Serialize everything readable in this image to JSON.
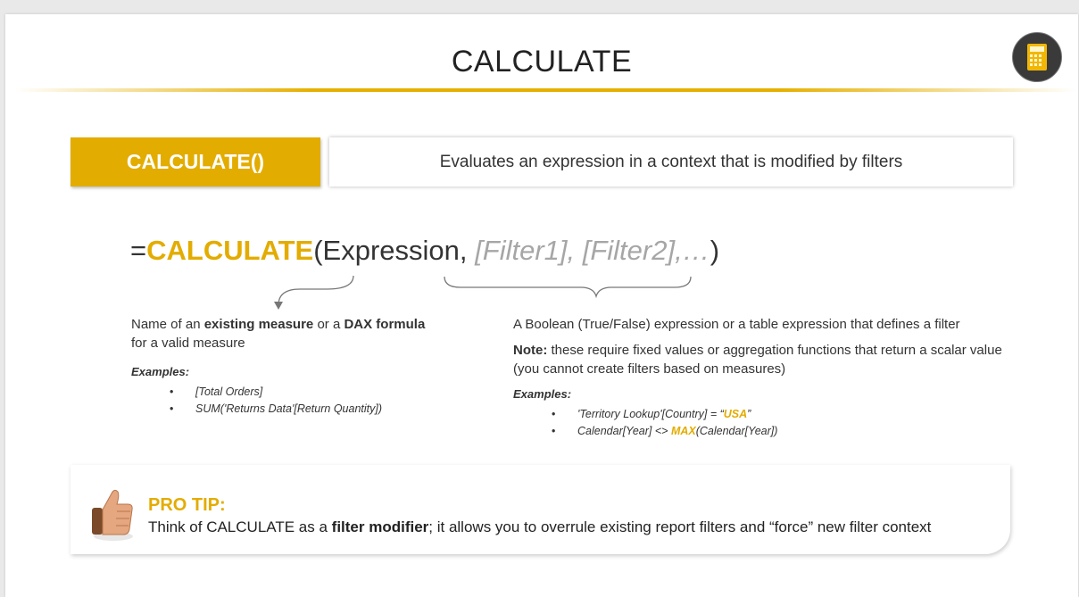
{
  "slide": {
    "title": "CALCULATE",
    "icon": "calculator-icon",
    "accent_color": "#e3ac00"
  },
  "function_box": {
    "name": "CALCULATE()",
    "description": "Evaluates an expression in a context that is modified by filters"
  },
  "syntax": {
    "equals": "=",
    "function": "CALCULATE",
    "open": "(Expression, ",
    "optional": "[Filter1], [Filter2],…",
    "close": ")"
  },
  "expression_note": {
    "line1_pre": "Name of an ",
    "line1_bold1": "existing measure",
    "line1_mid": " or a ",
    "line1_bold2": "DAX formula",
    "line2": "for a valid measure",
    "examples_label": "Examples:",
    "examples": [
      "[Total Orders]",
      "SUM('Returns Data'[Return Quantity])"
    ]
  },
  "filter_note": {
    "line1": "A Boolean (True/False) expression or a table expression that defines a filter",
    "note_label": "Note:",
    "note_text": " these require fixed values or aggregation functions that return a scalar value (you cannot create filters based on measures)",
    "examples_label": "Examples:",
    "example1_pre": "'Territory Lookup'[Country] = “",
    "example1_value": "USA",
    "example1_post": "”",
    "example2_pre": "Calendar[Year] <> ",
    "example2_fn": "MAX",
    "example2_post": "(Calendar[Year])"
  },
  "pro_tip": {
    "title": "PRO TIP:",
    "text_pre": "Think of CALCULATE as a ",
    "text_bold": "filter modifier",
    "text_post": "; it allows you to overrule existing report filters and “force” new filter context",
    "icon": "thumbs-up-icon"
  }
}
